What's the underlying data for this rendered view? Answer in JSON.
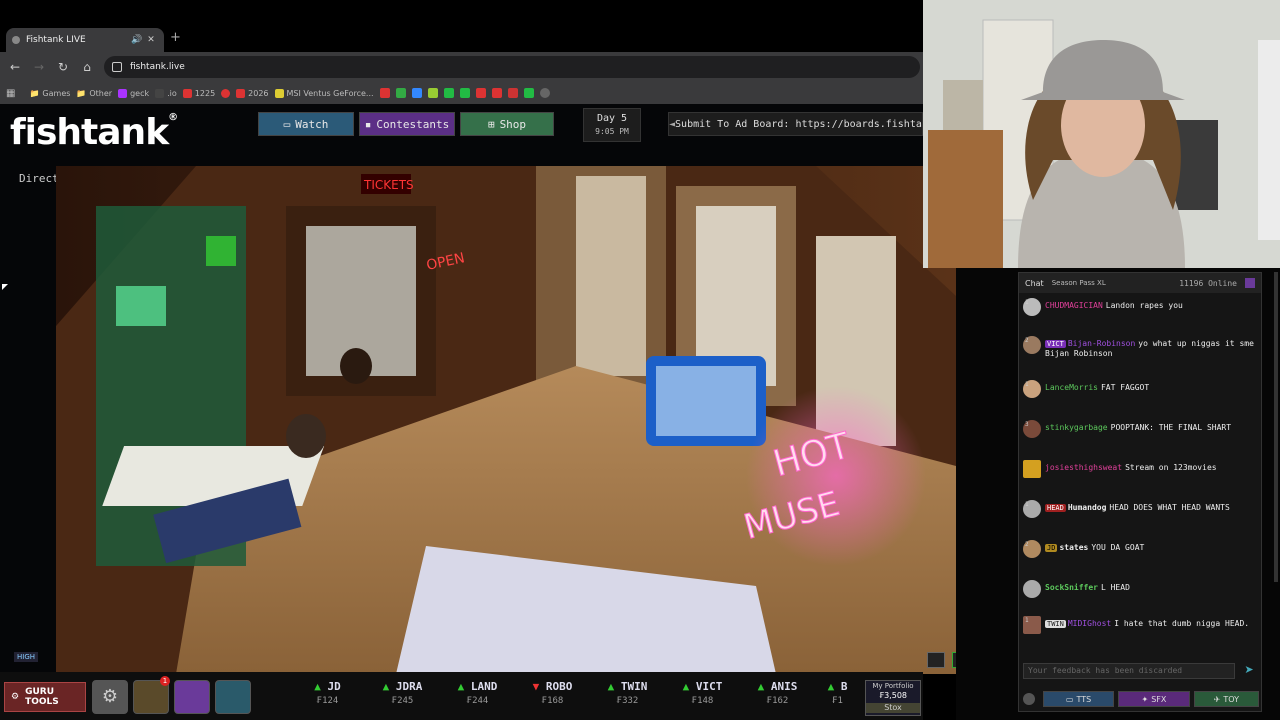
{
  "browser": {
    "tab_title": "Fishtank LIVE",
    "new_tab": "+",
    "url": "fishtank.live",
    "bookmarks": [
      "Games",
      "Other",
      "geck",
      "1225",
      "2026",
      "MSI Ventus GeForce..."
    ]
  },
  "site": {
    "logo": "fishtank",
    "logo_mark": "®",
    "nav": {
      "watch": "Watch",
      "contestants": "Contestants",
      "shop": "Shop"
    },
    "day": {
      "label": "Day 5",
      "time": "9:05 PM"
    },
    "adboard": "Submit To Ad Board: https://boards.fishtank.live",
    "director_mode": "Director Mode",
    "quality": "HIGH"
  },
  "bottom": {
    "guru_label": "GURU TOOLS",
    "notify_count": "1",
    "tickers": [
      {
        "symbol": "JD",
        "trend": "up",
        "price": "₣124"
      },
      {
        "symbol": "JDRA",
        "trend": "up",
        "price": "₣245"
      },
      {
        "symbol": "LAND",
        "trend": "up",
        "price": "₣244"
      },
      {
        "symbol": "ROBO",
        "trend": "down",
        "price": "₣168"
      },
      {
        "symbol": "TWIN",
        "trend": "up",
        "price": "₣332"
      },
      {
        "symbol": "VICT",
        "trend": "up",
        "price": "₣148"
      },
      {
        "symbol": "ANIS",
        "trend": "up",
        "price": "₣162"
      },
      {
        "symbol": "B",
        "trend": "up",
        "price": "₣1"
      }
    ],
    "portfolio": {
      "label": "My Portfolio",
      "value": "₣3,508",
      "stox": "Stox"
    }
  },
  "chat": {
    "title": "Chat",
    "pass": "Season Pass XL",
    "online": "11196 Online",
    "input_placeholder": "Your feedback has been discarded",
    "tools": {
      "tts": "TTS",
      "sfx": "SFX",
      "toy": "TOY"
    },
    "messages": [
      {
        "level": "1",
        "user": "CHUDMAGICIAN",
        "badge": "",
        "text": "Landon rapes you",
        "color": "#e0409a",
        "avatar": "#bbb"
      },
      {
        "level": "2",
        "user": "Bijan-Robinson",
        "badge": "VICT",
        "badge_color": "#7a2fb8",
        "text": "yo what up niggas it sme Bijan Robinson",
        "color": "#a050e0",
        "avatar": "#9a7a60"
      },
      {
        "level": "1",
        "user": "LanceMorris",
        "badge": "",
        "text": "FAT FAGGOT",
        "color": "#5cc85c",
        "avatar": "#c9a27e"
      },
      {
        "level": "3",
        "user": "stinkygarbage",
        "badge": "",
        "text": "POOPTANK: THE FINAL SHART",
        "color": "#5cc85c",
        "avatar": "#7a4a3a"
      },
      {
        "level": "",
        "user": "josiesthighsweat",
        "badge": "",
        "text": "Stream on 123movies",
        "color": "#e0409a",
        "avatar": "#d4a020"
      },
      {
        "level": "1",
        "user": "Humandog",
        "badge": "HEAD",
        "badge_color": "#a02020",
        "text": "HEAD DOES WHAT HEAD WANTS",
        "color": "#eee",
        "avatar": "#aaa"
      },
      {
        "level": "2",
        "user": "states",
        "badge": "JD",
        "badge_color": "#b08a20",
        "text": "YOU DA GOAT",
        "color": "#eee",
        "avatar": "#b08a60"
      },
      {
        "level": "",
        "user": "SockSniffer",
        "badge": "",
        "text": "L HEAD",
        "color": "#5cc85c",
        "avatar": "#aaa"
      },
      {
        "level": "1",
        "user": "MIDIGhost",
        "badge": "TWIN",
        "badge_color": "#4a4a4a",
        "text": "I hate that dumb nigga HEAD.",
        "color": "#a050e0",
        "avatar": "#8a5a4a"
      }
    ]
  }
}
